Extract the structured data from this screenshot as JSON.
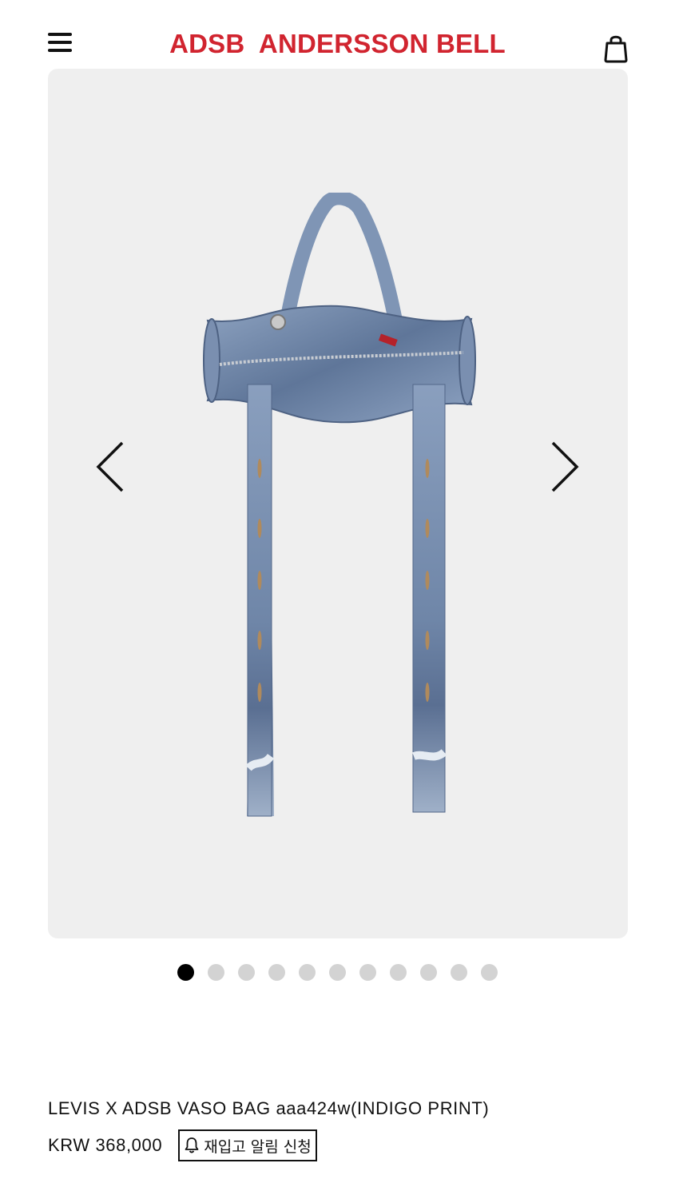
{
  "header": {
    "brand_logo": "ADSB  ANDERSSON BELL",
    "brand_color": "#d1242f",
    "menu_icon": "hamburger-menu-icon",
    "cart_icon": "shopping-bag-icon"
  },
  "gallery": {
    "image_icon": "denim-bag-product-image",
    "prev_icon": "chevron-left-icon",
    "next_icon": "chevron-right-icon",
    "slide_count": 11,
    "active_index": 0
  },
  "product": {
    "title": "LEVIS X ADSB VASO BAG aaa424w(INDIGO PRINT)",
    "price": "KRW 368,000",
    "restock_label": "재입고 알림 신청",
    "restock_icon": "bell-icon"
  }
}
